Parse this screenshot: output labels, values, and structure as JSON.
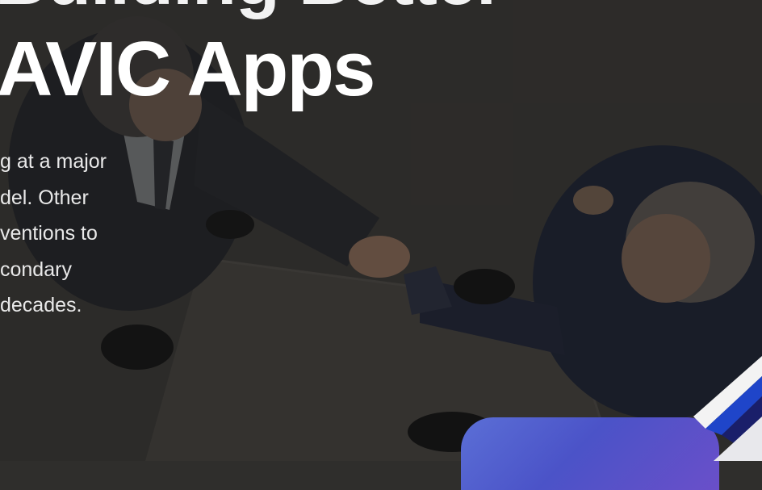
{
  "hero": {
    "headline_top": "Building Better",
    "headline": "AVIC Apps",
    "paragraph_lines": [
      "g at a major",
      "del. Other",
      "ventions to",
      "condary",
      " decades."
    ]
  },
  "colors": {
    "overlay": "#2f2e2c",
    "headline": "#ffffff",
    "paragraph": "#e9e9e9",
    "card_gradient_start": "#5b6fd6",
    "card_gradient_end": "#6a4fc9",
    "accent_blue": "#1f45c9"
  }
}
